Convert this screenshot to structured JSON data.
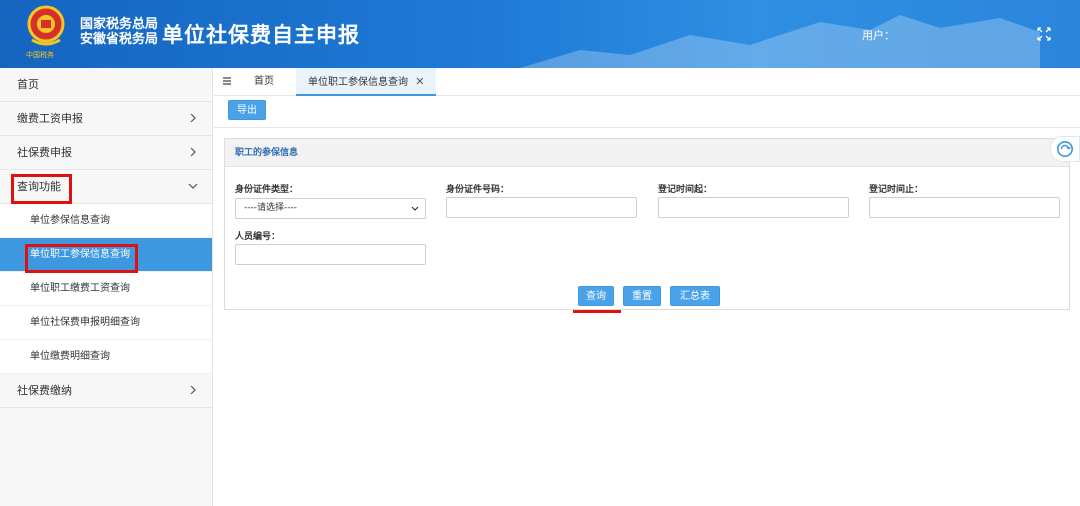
{
  "header": {
    "org_line1": "国家税务总局",
    "org_line2": "安徽省税务局",
    "app_title": "单位社保费自主申报",
    "user_label": "用户：",
    "logo_caption": "中国税务",
    "colors": {
      "primary": "#1e7ad6",
      "accent": "#3d98e0",
      "highlight": "#e01010"
    }
  },
  "sidebar": {
    "home": "首页",
    "items": [
      {
        "label": "缴费工资申报",
        "icon": "chevron-right-icon"
      },
      {
        "label": "社保费申报",
        "icon": "chevron-right-icon"
      },
      {
        "label": "查询功能",
        "icon": "chevron-down-icon"
      }
    ],
    "submenu": [
      {
        "label": "单位参保信息查询"
      },
      {
        "label": "单位职工参保信息查询",
        "active": true
      },
      {
        "label": "单位职工缴费工资查询"
      },
      {
        "label": "单位社保费申报明细查询"
      },
      {
        "label": "单位缴费明细查询"
      }
    ],
    "last_item": {
      "label": "社保费缴纳",
      "icon": "chevron-right-icon"
    }
  },
  "tabs": [
    {
      "label": "首页"
    },
    {
      "label": "单位职工参保信息查询",
      "closable": true,
      "close_glyph": "✕"
    }
  ],
  "toolbar": {
    "export_label": "导出"
  },
  "panel": {
    "title": "职工的参保信息",
    "fields": {
      "id_type_label": "身份证件类型：",
      "id_type_value": "----请选择----",
      "id_number_label": "身份证件号码：",
      "reg_start_label": "登记时间起：",
      "reg_end_label": "登记时间止：",
      "person_no_label": "人员编号："
    },
    "buttons": {
      "query": "查询",
      "reset": "重置",
      "summary": "汇总表"
    }
  }
}
